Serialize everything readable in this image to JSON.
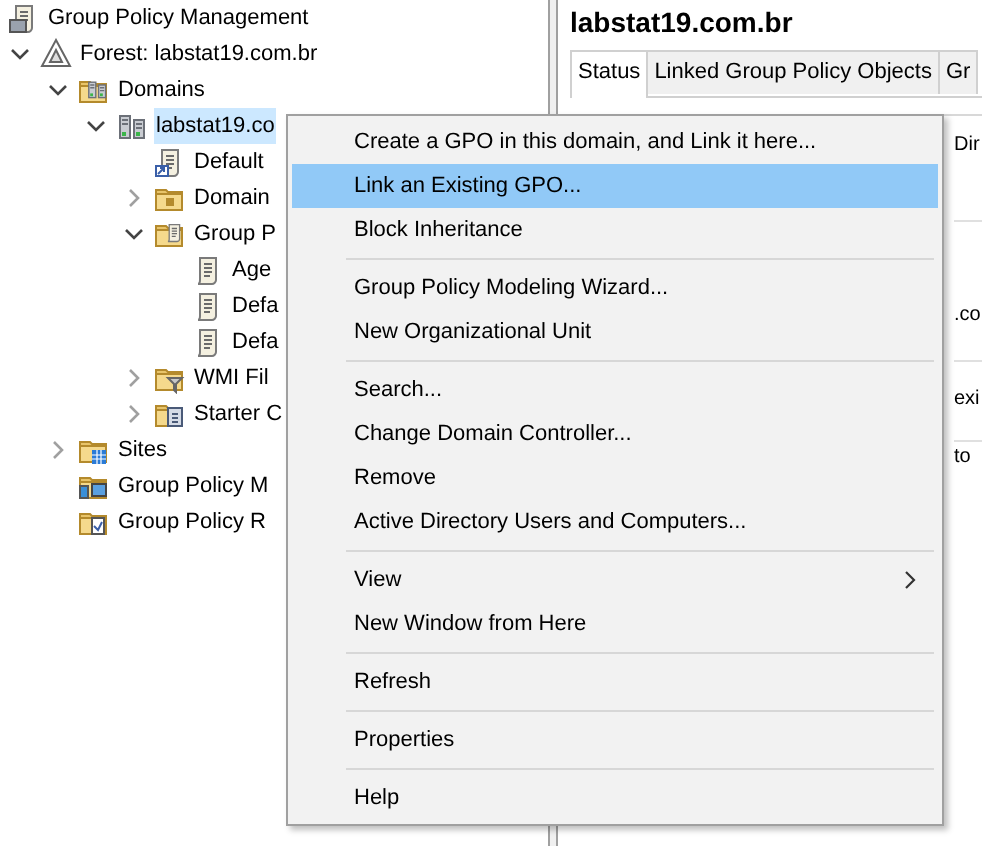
{
  "tree": [
    {
      "label": "Group Policy Management",
      "kind": "console",
      "children": [
        {
          "label": "Forest: labstat19.com.br",
          "kind": "forest",
          "expanded": true,
          "children": [
            {
              "label": "Domains",
              "kind": "domains",
              "expanded": true,
              "children": [
                {
                  "label": "labstat19.co",
                  "kind": "domain",
                  "expanded": true,
                  "selected": true,
                  "children": [
                    {
                      "label": "Default",
                      "kind": "gpo-link"
                    },
                    {
                      "label": "Domain",
                      "kind": "folder",
                      "expanded": false
                    },
                    {
                      "label": "Group P",
                      "kind": "gpo-folder",
                      "expanded": true,
                      "children": [
                        {
                          "label": "Age",
                          "kind": "gpo"
                        },
                        {
                          "label": "Defa",
                          "kind": "gpo"
                        },
                        {
                          "label": "Defa",
                          "kind": "gpo"
                        }
                      ]
                    },
                    {
                      "label": "WMI Fil",
                      "kind": "filter-folder",
                      "expanded": false
                    },
                    {
                      "label": "Starter C",
                      "kind": "starter-folder",
                      "expanded": false
                    }
                  ]
                }
              ]
            },
            {
              "label": "Sites",
              "kind": "sites",
              "expanded": false
            },
            {
              "label": "Group Policy M",
              "kind": "modeling"
            },
            {
              "label": "Group Policy R",
              "kind": "results"
            }
          ]
        }
      ]
    }
  ],
  "details": {
    "title": "labstat19.com.br",
    "tabs": [
      {
        "label": "Status",
        "selected": true
      },
      {
        "label": "Linked Group Policy Objects",
        "selected": false
      },
      {
        "label": "Gr",
        "selected": false
      }
    ],
    "fragments": [
      "Dir",
      ".co",
      "exi",
      "to"
    ]
  },
  "context_menu": [
    {
      "kind": "item",
      "label": "Create a GPO in this domain, and Link it here...",
      "selected": false
    },
    {
      "kind": "item",
      "label": "Link an Existing GPO...",
      "selected": true
    },
    {
      "kind": "item",
      "label": "Block Inheritance",
      "selected": false
    },
    {
      "kind": "separator"
    },
    {
      "kind": "item",
      "label": "Group Policy Modeling Wizard...",
      "selected": false
    },
    {
      "kind": "item",
      "label": "New Organizational Unit",
      "selected": false
    },
    {
      "kind": "separator"
    },
    {
      "kind": "item",
      "label": "Search...",
      "selected": false
    },
    {
      "kind": "item",
      "label": "Change Domain Controller...",
      "selected": false
    },
    {
      "kind": "item",
      "label": "Remove",
      "selected": false
    },
    {
      "kind": "item",
      "label": "Active Directory Users and Computers...",
      "selected": false
    },
    {
      "kind": "separator"
    },
    {
      "kind": "submenu",
      "label": "View",
      "selected": false
    },
    {
      "kind": "item",
      "label": "New Window from Here",
      "selected": false
    },
    {
      "kind": "separator"
    },
    {
      "kind": "item",
      "label": "Refresh",
      "selected": false
    },
    {
      "kind": "separator"
    },
    {
      "kind": "item",
      "label": "Properties",
      "selected": false
    },
    {
      "kind": "separator"
    },
    {
      "kind": "item",
      "label": "Help",
      "selected": false
    }
  ]
}
